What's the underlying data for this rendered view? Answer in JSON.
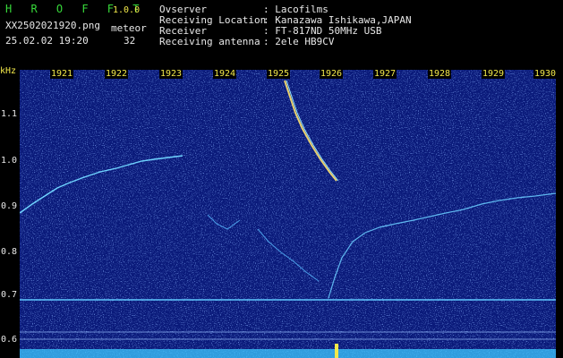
{
  "app": {
    "name": "H R O F F T",
    "version": "1.0.0"
  },
  "file": {
    "name": "XX2502021920.png",
    "datetime": "25.02.02 19:20"
  },
  "meteor": {
    "label": "meteor",
    "count": "32"
  },
  "info": [
    {
      "key": "Ovserver",
      "value": ": Lacofilms"
    },
    {
      "key": "Receiving Location",
      "value": ": Kanazawa Ishikawa,JAPAN"
    },
    {
      "key": "Receiver",
      "value": ": FT-817ND 50MHz USB"
    },
    {
      "key": "Receiving antenna",
      "value": ": 2ele HB9CV"
    }
  ],
  "y_unit": "kHz",
  "y_ticks": [
    "1.1",
    "1.0",
    "0.9",
    "0.8",
    "0.7",
    "0.6"
  ],
  "x_ticks": [
    "1921",
    "1922",
    "1923",
    "1924",
    "1925",
    "1926",
    "1927",
    "1928",
    "1929",
    "1930"
  ],
  "colors": {
    "background": "#000000",
    "spectro_bg": "#0a1a7a",
    "trace": "#6fd4ff",
    "label_yellow": "#f2e84a",
    "label_white": "#e8e8e8",
    "title_green": "#37d93a"
  }
}
